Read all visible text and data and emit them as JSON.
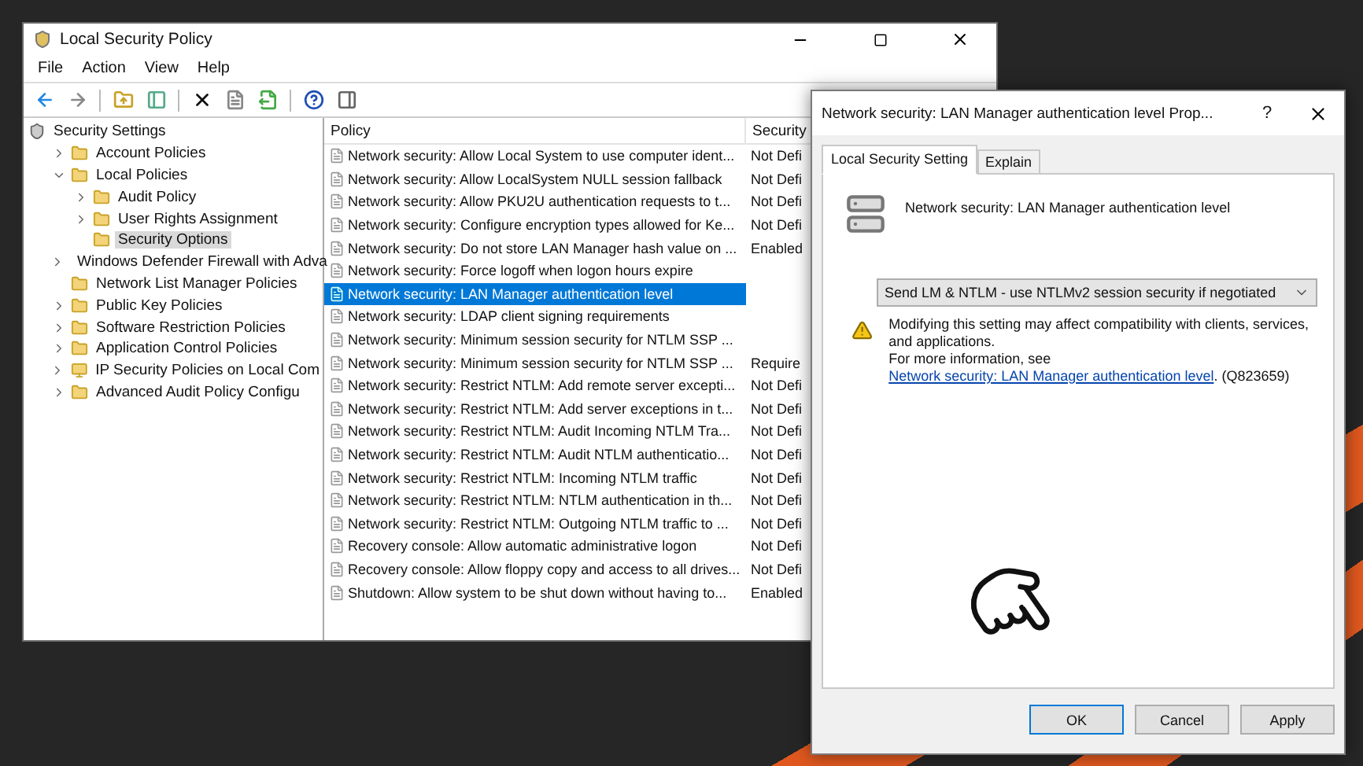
{
  "window": {
    "title": "Local Security Policy"
  },
  "menu": [
    "File",
    "Action",
    "View",
    "Help"
  ],
  "tree": {
    "label": "Security Settings",
    "selected": false,
    "children": [
      {
        "label": "Account Policies",
        "selected": false,
        "expanded": false
      },
      {
        "label": "Local Policies",
        "selected": false,
        "expanded": true,
        "children": [
          {
            "label": "Audit Policy",
            "selected": false,
            "expanded": false
          },
          {
            "label": "User Rights Assignment",
            "selected": false,
            "expanded": false
          },
          {
            "label": "Security Options",
            "selected": true
          }
        ]
      },
      {
        "label": "Windows Defender Firewall with Adva",
        "selected": false,
        "expanded": false
      },
      {
        "label": "Network List Manager Policies",
        "selected": false
      },
      {
        "label": "Public Key Policies",
        "selected": false,
        "expanded": false
      },
      {
        "label": "Software Restriction Policies",
        "selected": false,
        "expanded": false
      },
      {
        "label": "Application Control Policies",
        "selected": false,
        "expanded": false
      },
      {
        "label": "IP Security Policies on Local Com",
        "selected": false,
        "expanded": false,
        "kind": "computer"
      },
      {
        "label": "Advanced Audit Policy Configu",
        "selected": false,
        "expanded": false
      }
    ]
  },
  "table": {
    "columns": [
      "Policy",
      "Security"
    ],
    "rows": [
      {
        "policy": "Network security: Allow Local System to use computer ident...",
        "security": "Not Defi",
        "selected": false
      },
      {
        "policy": "Network security: Allow LocalSystem NULL session fallback",
        "security": "Not Defi",
        "selected": false
      },
      {
        "policy": "Network security: Allow PKU2U authentication requests to t...",
        "security": "Not Defi",
        "selected": false
      },
      {
        "policy": "Network security: Configure encryption types allowed for Ke...",
        "security": "Not Defi",
        "selected": false
      },
      {
        "policy": "Network security: Do not store LAN Manager hash value on ...",
        "security": "Enabled",
        "selected": false
      },
      {
        "policy": "Network security: Force logoff when logon hours expire",
        "selected": false
      },
      {
        "policy": "Network security: LAN Manager authentication level",
        "selected": true
      },
      {
        "policy": "Network security: LDAP client signing requirements",
        "selected": false
      },
      {
        "policy": "Network security: Minimum session security for NTLM SSP ...",
        "selected": false
      },
      {
        "policy": "Network security: Minimum session security for NTLM SSP ...",
        "security": "Require",
        "selected": false
      },
      {
        "policy": "Network security: Restrict NTLM: Add remote server excepti...",
        "security": "Not Defi",
        "selected": false
      },
      {
        "policy": "Network security: Restrict NTLM: Add server exceptions in t...",
        "security": "Not Defi",
        "selected": false
      },
      {
        "policy": "Network security: Restrict NTLM: Audit Incoming NTLM Tra...",
        "security": "Not Defi",
        "selected": false
      },
      {
        "policy": "Network security: Restrict NTLM: Audit NTLM authenticatio...",
        "security": "Not Defi",
        "selected": false
      },
      {
        "policy": "Network security: Restrict NTLM: Incoming NTLM traffic",
        "security": "Not Defi",
        "selected": false
      },
      {
        "policy": "Network security: Restrict NTLM: NTLM authentication in th...",
        "security": "Not Defi",
        "selected": false
      },
      {
        "policy": "Network security: Restrict NTLM: Outgoing NTLM traffic to ...",
        "security": "Not Defi",
        "selected": false
      },
      {
        "policy": "Recovery console: Allow automatic administrative logon",
        "security": "Not Defi",
        "selected": false
      },
      {
        "policy": "Recovery console: Allow floppy copy and access to all drives...",
        "security": "Not Defi",
        "selected": false
      },
      {
        "policy": "Shutdown: Allow system to be shut down without having to...",
        "security": "Enabled",
        "selected": false
      }
    ]
  },
  "dialog": {
    "title": "Network security: LAN Manager authentication level Prop...",
    "help": "?",
    "tabs": [
      {
        "label": "Local Security Setting",
        "selected": true
      },
      {
        "label": "Explain",
        "selected": false
      }
    ],
    "policy_name": "Network security: LAN Manager authentication level",
    "dropdown": {
      "value": "Send LM & NTLM - use NTLMv2 session security if negotiated"
    },
    "warning": "Modifying this setting may affect compatibility with clients, services, and applications.",
    "info": {
      "prefix": "For more information, see ",
      "link": "Network security: LAN Manager authentication level",
      "suffix": ". (Q823659)"
    },
    "buttons": [
      {
        "label": "OK",
        "default": true
      },
      {
        "label": "Cancel",
        "default": false
      },
      {
        "label": "Apply",
        "default": false
      }
    ]
  }
}
